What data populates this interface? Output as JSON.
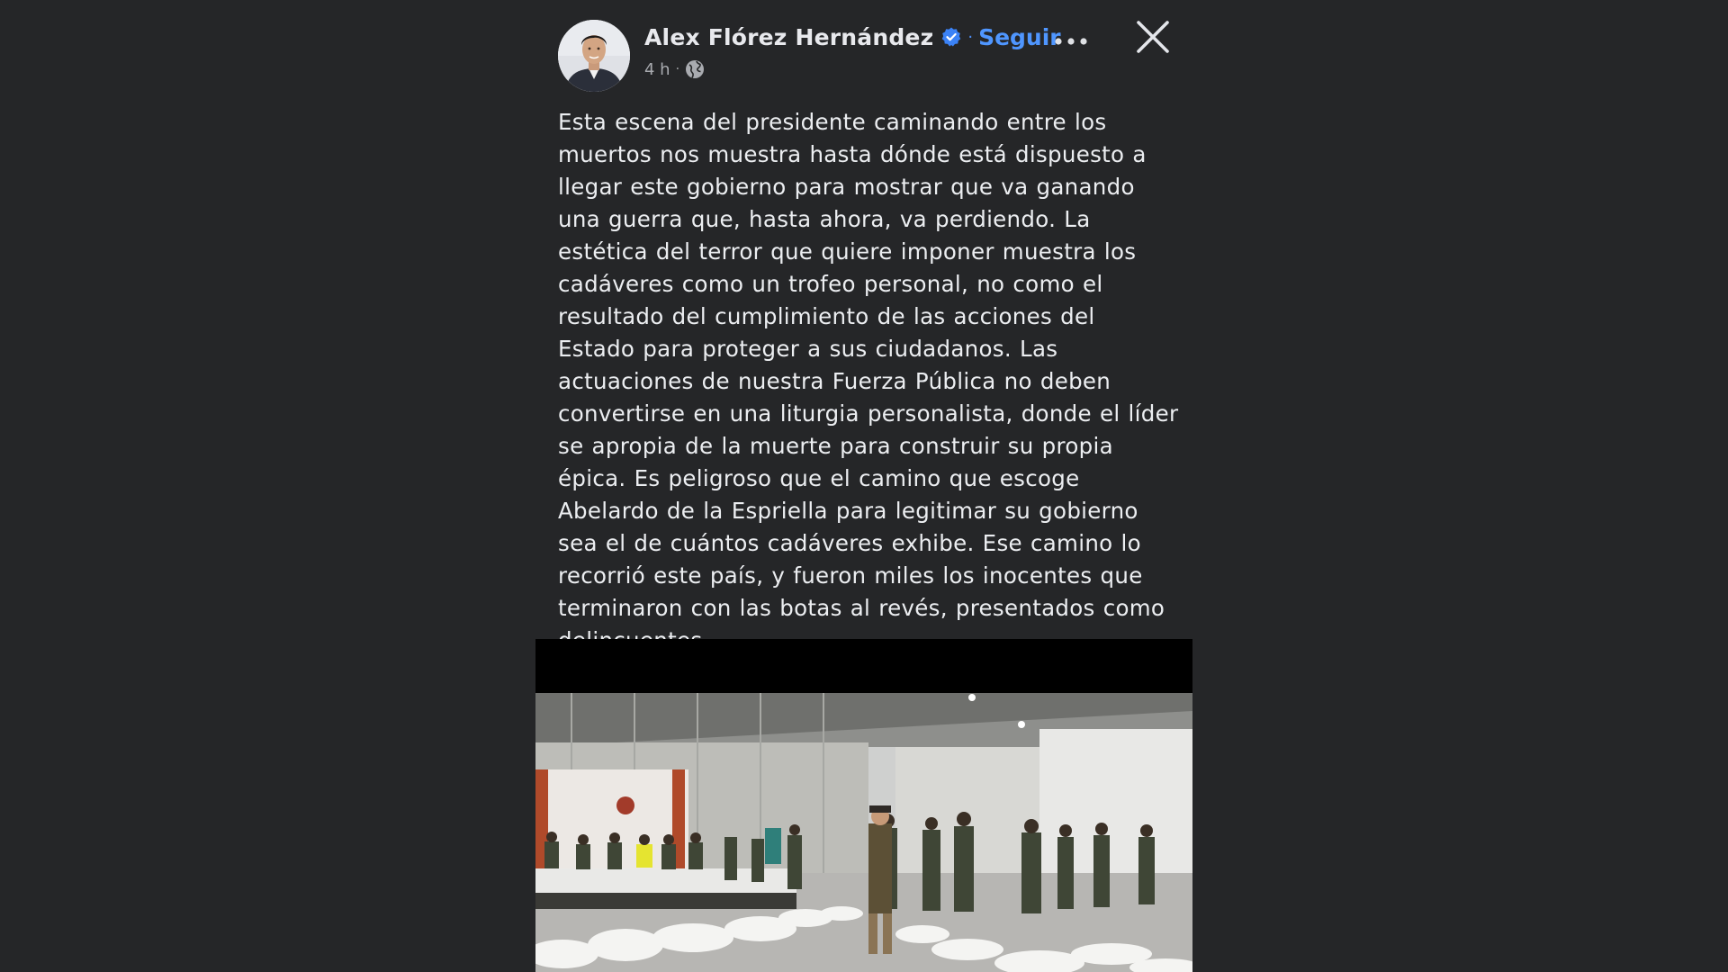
{
  "post": {
    "author": {
      "name": "Alex Flórez Hernández",
      "verified": true,
      "avatar_icon": "avatar-photo"
    },
    "follow_label": "Seguir",
    "separator": "·",
    "timestamp": "4 h",
    "visibility_icon": "globe-icon",
    "text": "Esta escena del presidente caminando entre los muertos nos muestra hasta dónde está dispuesto a llegar este gobierno para mostrar que va ganando una guerra que, hasta ahora, va perdiendo. La estética del terror que quiere imponer muestra los cadáveres como un trofeo personal, no como el resultado del cumplimiento de las acciones del Estado para proteger a sus ciudadanos. Las actuaciones de nuestra Fuerza Pública no deben convertirse en una liturgia personalista, donde el líder se apropia de la muerte para construir su propia épica. Es peligroso que el camino que escoge Abelardo de la Espriella para legitimar su gobierno sea el de cuántos cadáveres exhibe. Ese camino lo recorrió este país, y fueron miles los inocentes que terminaron con las botas al revés, presentados como delincuentes.",
    "media": {
      "kind": "video-thumbnail"
    }
  },
  "colors": {
    "background": "#252628",
    "text": "#eceef1",
    "link": "#4f96ff",
    "verified_badge": "#3b82f6",
    "muted": "#a9abb0"
  },
  "icons": [
    "verified-badge-icon",
    "globe-icon",
    "more-options-icon",
    "close-icon"
  ]
}
